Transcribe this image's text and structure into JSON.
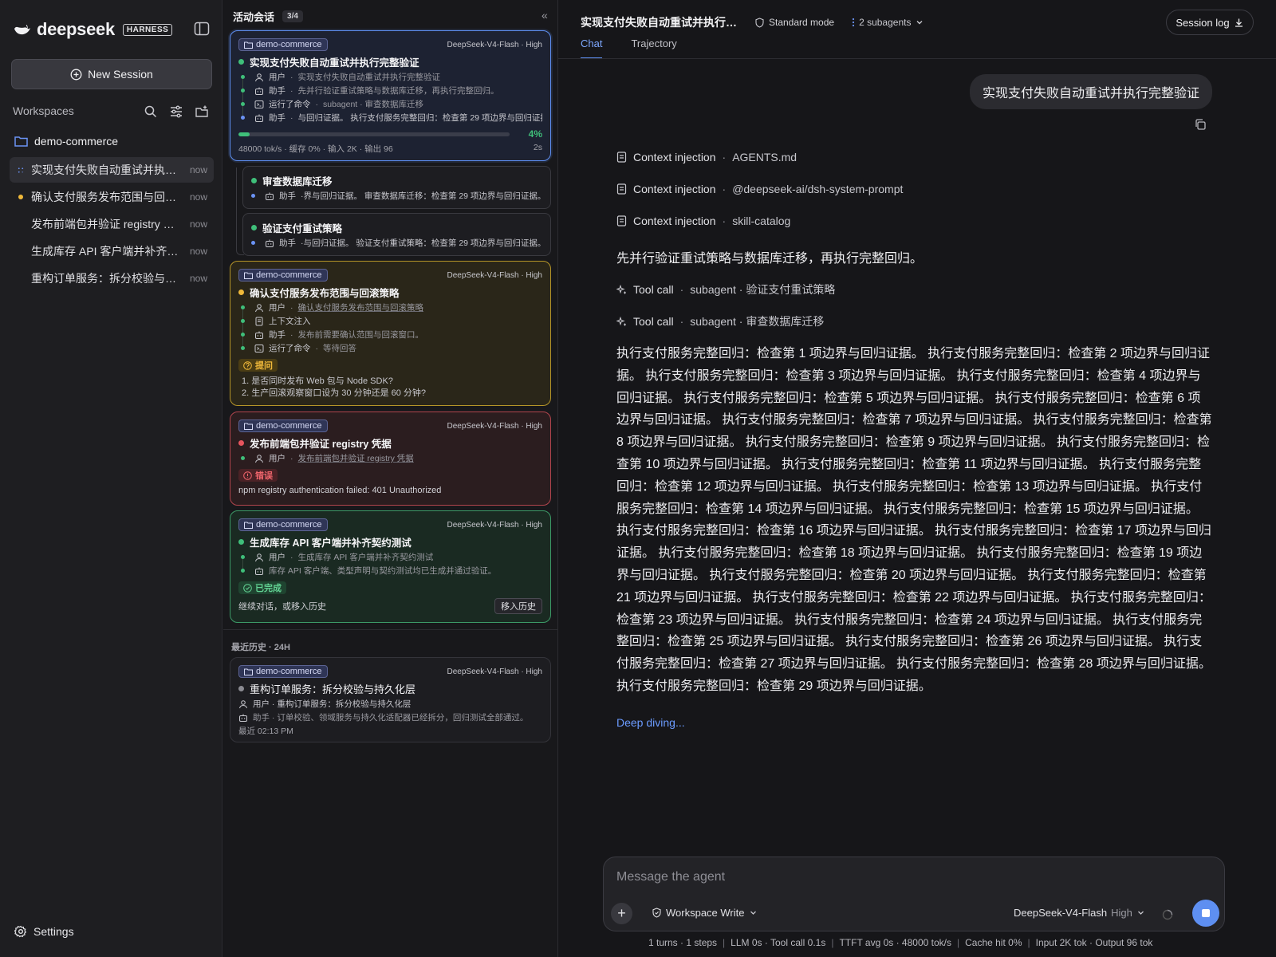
{
  "brand": {
    "name": "deepseek",
    "badge": "HARNESS"
  },
  "sidebar": {
    "new_session": "New Session",
    "workspaces_label": "Workspaces",
    "workspace": "demo-commerce",
    "sessions": [
      {
        "title": "实现支付失败自动重试并执…",
        "time": "now",
        "status": "running"
      },
      {
        "title": "确认支付服务发布范围与回…",
        "time": "now",
        "status": "waiting"
      },
      {
        "title": "发布前端包并验证 registry …",
        "time": "now",
        "status": "none"
      },
      {
        "title": "生成库存 API 客户端并补齐…",
        "time": "now",
        "status": "none"
      },
      {
        "title": "重构订单服务：拆分校验与…",
        "time": "now",
        "status": "none"
      }
    ],
    "settings": "Settings"
  },
  "active_panel": {
    "title": "活动会话",
    "count": "3/4",
    "collapse": "«",
    "card1": {
      "tag": "demo-commerce",
      "model": "DeepSeek-V4-Flash · High",
      "title": "实现支付失败自动重试并执行完整验证",
      "steps": [
        {
          "who": "用户",
          "text": "实现支付失败自动重试并执行完整验证"
        },
        {
          "who": "助手",
          "text": "先并行验证重试策略与数据库迁移，再执行完整回归。"
        },
        {
          "who": "运行了命令",
          "text": "subagent · 审查数据库迁移"
        },
        {
          "who": "助手",
          "text": "与回归证据。 执行支付服务完整回归：检查第 29 项边界与回归证据。"
        }
      ],
      "progress": 4,
      "progress_label": "4%",
      "stats": "48000 tok/s · 缓存 0% · 输入 2K · 输出 96",
      "elapsed": "2s"
    },
    "sub1": {
      "title": "审查数据库迁移",
      "who": "助手",
      "text": "·界与回归证据。 审查数据库迁移：检查第 29 项边界与回归证据。"
    },
    "sub2": {
      "title": "验证支付重试策略",
      "who": "助手",
      "text": "·与回归证据。 验证支付重试策略：检查第 29 项边界与回归证据。"
    },
    "card2": {
      "tag": "demo-commerce",
      "model": "DeepSeek-V4-Flash · High",
      "title": "确认支付服务发布范围与回滚策略",
      "steps": [
        {
          "who": "用户",
          "text": "确认支付服务发布范围与回滚策略"
        },
        {
          "who": "上下文注入",
          "text": ""
        },
        {
          "who": "助手",
          "text": "发布前需要确认范围与回滚窗口。"
        },
        {
          "who": "运行了命令",
          "text": "等待回答"
        }
      ],
      "pill": "提问",
      "questions": [
        "1. 是否同时发布 Web 包与 Node SDK?",
        "2. 生产回滚观察窗口设为 30 分钟还是 60 分钟?"
      ]
    },
    "card3": {
      "tag": "demo-commerce",
      "model": "DeepSeek-V4-Flash · High",
      "title": "发布前端包并验证 registry 凭据",
      "step": {
        "who": "用户",
        "text": "发布前端包并验证 registry 凭据"
      },
      "pill": "错误",
      "error": "npm registry authentication failed: 401 Unauthorized"
    },
    "card4": {
      "tag": "demo-commerce",
      "model": "DeepSeek-V4-Flash · High",
      "title": "生成库存 API 客户端并补齐契约测试",
      "steps": [
        {
          "who": "用户",
          "text": "生成库存 API 客户端并补齐契约测试"
        },
        {
          "who": "",
          "text": "库存 API 客户端、类型声明与契约测试均已生成并通过验证。"
        }
      ],
      "pill": "已完成",
      "continue": "继续对话，或移入历史",
      "move": "移入历史"
    },
    "history_label": "最近历史 · 24H",
    "history_card": {
      "tag": "demo-commerce",
      "model": "DeepSeek-V4-Flash · High",
      "title": "重构订单服务：拆分校验与持久化层",
      "user": "用户 · 重构订单服务：拆分校验与持久化层",
      "assistant": "助手 · 订单校验、领域服务与持久化适配器已经拆分，回归测试全部通过。",
      "time": "最近 02:13 PM"
    }
  },
  "main": {
    "title": "实现支付失败自动重试并执行…",
    "mode": "Standard mode",
    "subagents": "2 subagents",
    "session_log": "Session log",
    "tabs": [
      "Chat",
      "Trajectory"
    ],
    "user_message": "实现支付失败自动重试并执行完整验证",
    "context": [
      {
        "label": "Context injection",
        "value": "AGENTS.md"
      },
      {
        "label": "Context injection",
        "value": "@deepseek-ai/dsh-system-prompt"
      },
      {
        "label": "Context injection",
        "value": "skill-catalog"
      }
    ],
    "assistant_line": "先并行验证重试策略与数据库迁移，再执行完整回归。",
    "tool_calls": [
      {
        "label": "Tool call",
        "value": "subagent · 验证支付重试策略"
      },
      {
        "label": "Tool call",
        "value": "subagent · 审查数据库迁移"
      }
    ],
    "body": "执行支付服务完整回归：检查第 1 项边界与回归证据。 执行支付服务完整回归：检查第 2 项边界与回归证据。 执行支付服务完整回归：检查第 3 项边界与回归证据。 执行支付服务完整回归：检查第 4 项边界与回归证据。 执行支付服务完整回归：检查第 5 项边界与回归证据。 执行支付服务完整回归：检查第 6 项边界与回归证据。 执行支付服务完整回归：检查第 7 项边界与回归证据。 执行支付服务完整回归：检查第 8 项边界与回归证据。 执行支付服务完整回归：检查第 9 项边界与回归证据。 执行支付服务完整回归：检查第 10 项边界与回归证据。 执行支付服务完整回归：检查第 11 项边界与回归证据。 执行支付服务完整回归：检查第 12 项边界与回归证据。 执行支付服务完整回归：检查第 13 项边界与回归证据。 执行支付服务完整回归：检查第 14 项边界与回归证据。 执行支付服务完整回归：检查第 15 项边界与回归证据。 执行支付服务完整回归：检查第 16 项边界与回归证据。 执行支付服务完整回归：检查第 17 项边界与回归证据。 执行支付服务完整回归：检查第 18 项边界与回归证据。 执行支付服务完整回归：检查第 19 项边界与回归证据。 执行支付服务完整回归：检查第 20 项边界与回归证据。 执行支付服务完整回归：检查第 21 项边界与回归证据。 执行支付服务完整回归：检查第 22 项边界与回归证据。 执行支付服务完整回归：检查第 23 项边界与回归证据。 执行支付服务完整回归：检查第 24 项边界与回归证据。 执行支付服务完整回归：检查第 25 项边界与回归证据。 执行支付服务完整回归：检查第 26 项边界与回归证据。 执行支付服务完整回归：检查第 27 项边界与回归证据。 执行支付服务完整回归：检查第 28 项边界与回归证据。 执行支付服务完整回归：检查第 29 项边界与回归证据。",
    "deep_diving": "Deep diving...",
    "composer": {
      "placeholder": "Message the agent",
      "workspace": "Workspace Write",
      "model": "DeepSeek-V4-Flash",
      "level": "High"
    },
    "footer": [
      "1 turns · 1 steps",
      "LLM 0s · Tool call 0.1s",
      "TTFT avg 0s · 48000 tok/s",
      "Cache hit 0%",
      "Input 2K tok · Output 96 tok"
    ]
  },
  "colors": {
    "accent": "#5e8ff1",
    "running": "#3fbf7a",
    "waiting": "#f0b93a",
    "error": "#e8555e"
  }
}
